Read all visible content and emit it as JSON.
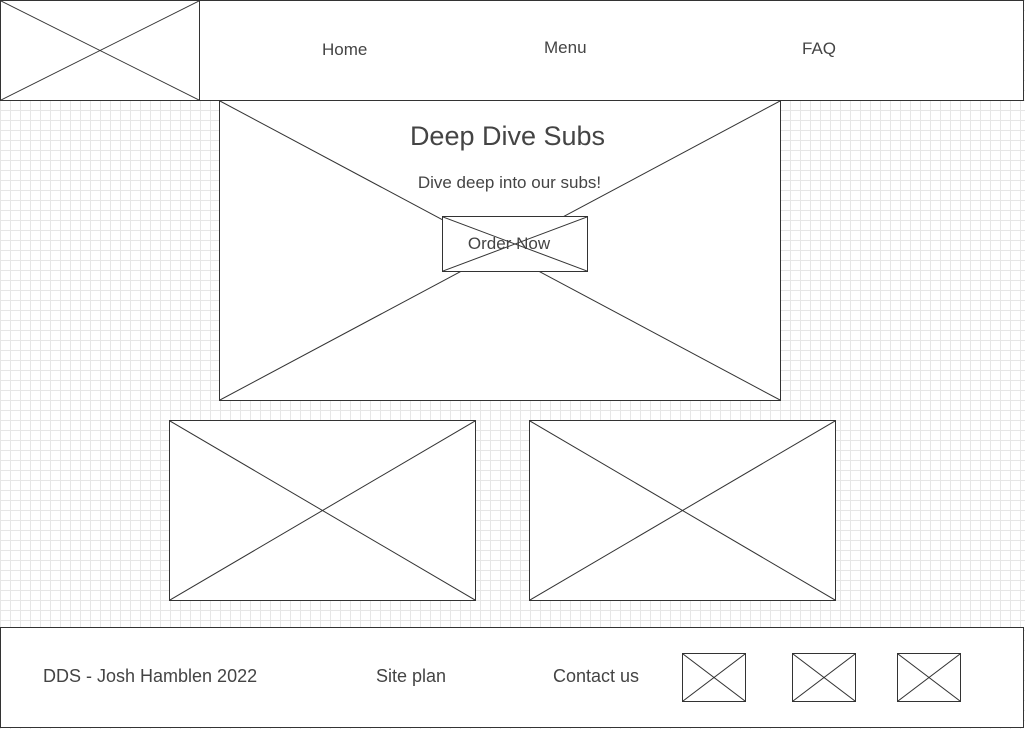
{
  "header": {
    "logo_icon": "image-placeholder-icon",
    "nav": [
      {
        "label": "Home"
      },
      {
        "label": "Menu"
      },
      {
        "label": "FAQ"
      }
    ]
  },
  "hero": {
    "background_icon": "image-placeholder-icon",
    "title": "Deep Dive Subs",
    "subtitle": "Dive deep into our subs!",
    "cta_label": "Order Now"
  },
  "features": {
    "image_icon": "image-placeholder-icon"
  },
  "footer": {
    "copyright": "DDS - Josh Hamblen 2022",
    "site_plan": "Site plan",
    "contact": "Contact us",
    "social_icon": "image-placeholder-icon"
  },
  "colors": {
    "border": "#333333",
    "text": "#444444",
    "grid": "#e6e6e6",
    "background": "#ffffff"
  }
}
